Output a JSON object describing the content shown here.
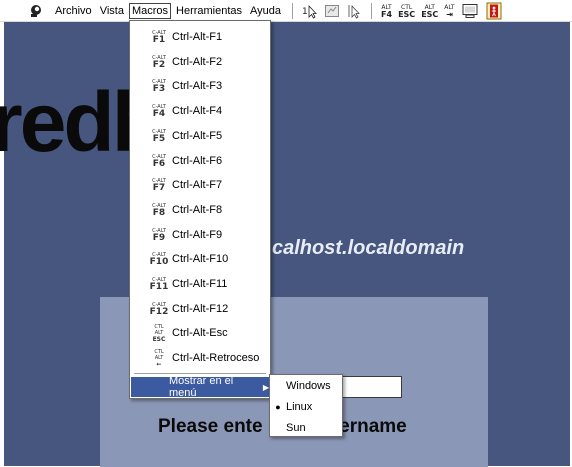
{
  "toolbar": {
    "menus": [
      "Archivo",
      "Vista",
      "Macros",
      "Herramientas",
      "Ayuda"
    ],
    "key_buttons": [
      {
        "top": "ALT",
        "bottom": "F4"
      },
      {
        "top": "CTL",
        "bottom": "ESC"
      },
      {
        "top": "ALT",
        "bottom": "ESC"
      },
      {
        "top": "ALT",
        "bottom": "⇥"
      }
    ]
  },
  "macros_menu": {
    "items": [
      {
        "label": "Ctrl-Alt-F1",
        "key_top": "C-ALT",
        "key_bottom": "F1"
      },
      {
        "label": "Ctrl-Alt-F2",
        "key_top": "C-ALT",
        "key_bottom": "F2"
      },
      {
        "label": "Ctrl-Alt-F3",
        "key_top": "C-ALT",
        "key_bottom": "F3"
      },
      {
        "label": "Ctrl-Alt-F4",
        "key_top": "C-ALT",
        "key_bottom": "F4"
      },
      {
        "label": "Ctrl-Alt-F5",
        "key_top": "C-ALT",
        "key_bottom": "F5"
      },
      {
        "label": "Ctrl-Alt-F6",
        "key_top": "C-ALT",
        "key_bottom": "F6"
      },
      {
        "label": "Ctrl-Alt-F7",
        "key_top": "C-ALT",
        "key_bottom": "F7"
      },
      {
        "label": "Ctrl-Alt-F8",
        "key_top": "C-ALT",
        "key_bottom": "F8"
      },
      {
        "label": "Ctrl-Alt-F9",
        "key_top": "C-ALT",
        "key_bottom": "F9"
      },
      {
        "label": "Ctrl-Alt-F10",
        "key_top": "C-ALT",
        "key_bottom": "F10"
      },
      {
        "label": "Ctrl-Alt-F11",
        "key_top": "C-ALT",
        "key_bottom": "F11"
      },
      {
        "label": "Ctrl-Alt-F12",
        "key_top": "C-ALT",
        "key_bottom": "F12"
      },
      {
        "label": "Ctrl-Alt-Esc",
        "key_top": "CTL",
        "key_mid": "ALT",
        "key_bottom": "ESC"
      },
      {
        "label": "Ctrl-Alt-Retroceso",
        "key_top": "CTL",
        "key_mid": "ALT",
        "key_bottom": "←"
      }
    ],
    "submenu_label": "Mostrar en el menú",
    "submenu": {
      "items": [
        "Windows",
        "Linux",
        "Sun"
      ],
      "selected": "Linux"
    }
  },
  "background": {
    "brand_fragment": "redh",
    "hostname_fragment": "calhost.localdomain",
    "login_prompt": "Please ente",
    "login_prompt_end": "sername"
  },
  "colors": {
    "desktop": "#46567f",
    "login_panel": "#8b97b6",
    "menu_highlight": "#3b5aa0"
  }
}
